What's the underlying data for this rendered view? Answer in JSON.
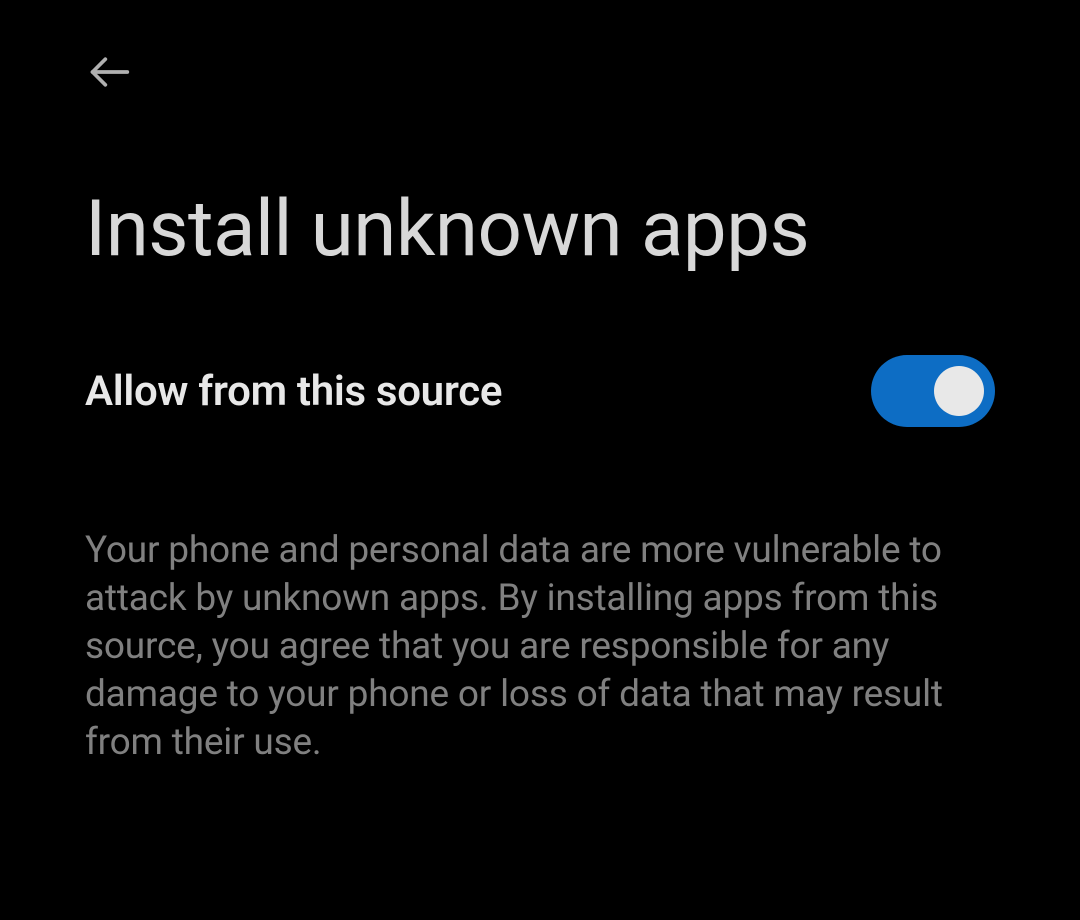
{
  "header": {
    "title": "Install unknown apps"
  },
  "setting": {
    "label": "Allow from this source",
    "enabled": true
  },
  "warning": {
    "text": "Your phone and personal data are more vulnerable to attack by unknown apps. By installing apps from this source, you agree that you are responsible for any damage to your phone or loss of data that may result from their use."
  }
}
